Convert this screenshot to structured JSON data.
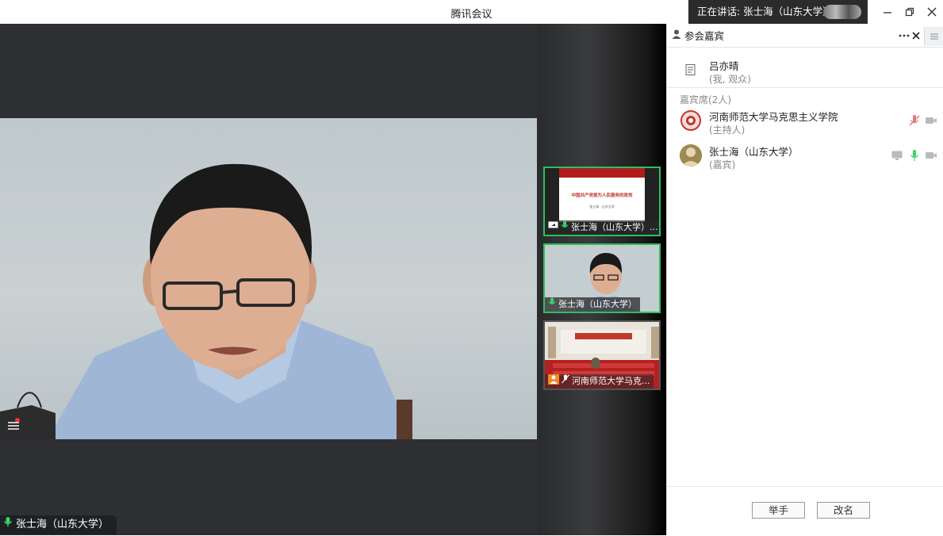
{
  "app": {
    "title": "腾讯会议"
  },
  "speaking_now": "正在讲话: 张士海（山东大学）;",
  "stage": {
    "speaker_label": "张士海（山东大学）"
  },
  "thumbnails": [
    {
      "label": "张士海（山东大学）...",
      "slide_title": "中国共产党是为人民服务的政党",
      "slide_sub": "张士海 · 山东大学"
    },
    {
      "label": "张士海（山东大学）"
    },
    {
      "label": "河南师范大学马克..."
    }
  ],
  "panel": {
    "title": "参会嘉宾",
    "self": {
      "name": "吕亦晴",
      "role": "(我, 观众)"
    },
    "section_label": "嘉宾席(2人)",
    "participants": [
      {
        "name": "河南师范大学马克思主义学院",
        "role": "(主持人)"
      },
      {
        "name": "张士海（山东大学）",
        "role": "(嘉宾)"
      }
    ],
    "raise_hand_label": "举手",
    "rename_label": "改名"
  },
  "colors": {
    "accent_green": "#2fbf5b",
    "muted_red": "#e27a7a"
  },
  "icons": [
    "person-icon",
    "more-icon",
    "close-icon",
    "menu-icon",
    "minimize-icon",
    "restore-icon",
    "mic-icon",
    "mic-muted-icon",
    "camera-icon",
    "screen-share-icon"
  ]
}
